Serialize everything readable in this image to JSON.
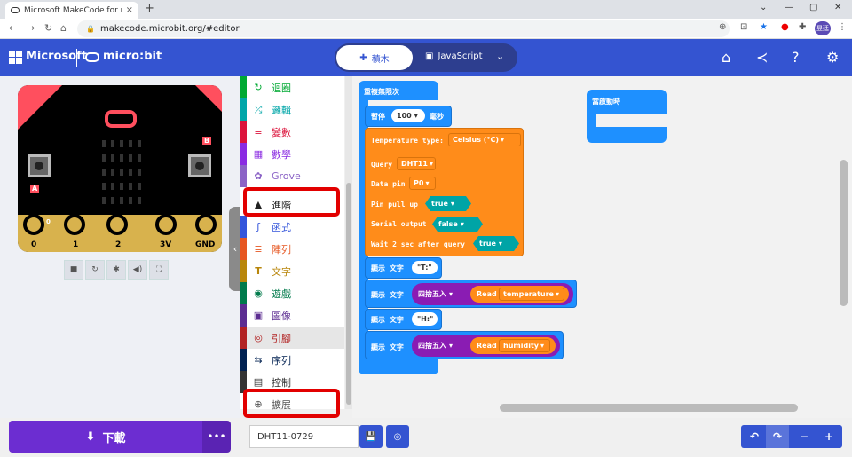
{
  "browser": {
    "tab_title": "Microsoft MakeCode for micro:",
    "tab_close": "×",
    "new_tab": "+",
    "url": "makecode.microbit.org/#editor",
    "window_controls": [
      "⌄",
      "—",
      "▢",
      "✕"
    ],
    "profile_label": "昱廷"
  },
  "header": {
    "microsoft": "Microsoft",
    "product": "micro:bit",
    "mode_blocks": "積木",
    "mode_js": "JavaScript",
    "icons": [
      "home-icon",
      "share-icon",
      "help-icon",
      "settings-icon"
    ]
  },
  "simulator": {
    "pins": [
      "0",
      "1",
      "2",
      "3V",
      "GND"
    ],
    "pin0_small": "0",
    "button_a": "A",
    "button_b": "B",
    "tools": [
      "stop-icon",
      "restart-icon",
      "debug-icon",
      "sound-icon",
      "fullscreen-icon"
    ]
  },
  "toolbox": {
    "categories": [
      {
        "label": "迴圈",
        "color": "#00a933",
        "icon": "↻"
      },
      {
        "label": "邏輯",
        "color": "#00a6a8",
        "icon": "⤮"
      },
      {
        "label": "變數",
        "color": "#dc143c",
        "icon": "≡"
      },
      {
        "label": "數學",
        "color": "#8a2be2",
        "icon": "▦"
      },
      {
        "label": "Grove",
        "color": "#8b63c6",
        "icon": "✿"
      },
      {
        "label": "進階",
        "color": "#222222",
        "icon": "▲"
      },
      {
        "label": "函式",
        "color": "#3455db",
        "icon": "ƒ"
      },
      {
        "label": "陣列",
        "color": "#e65722",
        "icon": "≣"
      },
      {
        "label": "文字",
        "color": "#b8860b",
        "icon": "T"
      },
      {
        "label": "遊戲",
        "color": "#007a4b",
        "icon": "◉"
      },
      {
        "label": "圖像",
        "color": "#5c2d91",
        "icon": "▣"
      },
      {
        "label": "引腳",
        "color": "#b22222",
        "icon": "◎"
      },
      {
        "label": "序列",
        "color": "#002050",
        "icon": "⇆"
      },
      {
        "label": "控制",
        "color": "#333333",
        "icon": "▤"
      },
      {
        "label": "擴展",
        "color": "#555555",
        "icon": "⊕"
      }
    ]
  },
  "workspace": {
    "forever": "重複無限次",
    "pause": "暫停",
    "pause_value": "100",
    "pause_unit": "毫秒",
    "temp_type_label": "Temperature type:",
    "temp_type_value": "Celsius (°C)",
    "query_label": "Query",
    "query_value": "DHT11",
    "data_pin_label": "Data pin",
    "data_pin_value": "P0",
    "pin_pull_label": "Pin pull up",
    "pin_pull_value": "true",
    "serial_label": "Serial output",
    "serial_value": "false",
    "wait_label": "Wait 2 sec after query",
    "wait_value": "true",
    "show_text": "顯示 文字",
    "text_t": "\"T:\"",
    "round": "四捨五入",
    "read": "Read",
    "read_temp": "temperature",
    "text_h": "\"H:\"",
    "read_hum": "humidity",
    "on_start": "當啟動時"
  },
  "bottom": {
    "download": "下載",
    "more": "•••",
    "project_name": "DHT11-0729"
  }
}
